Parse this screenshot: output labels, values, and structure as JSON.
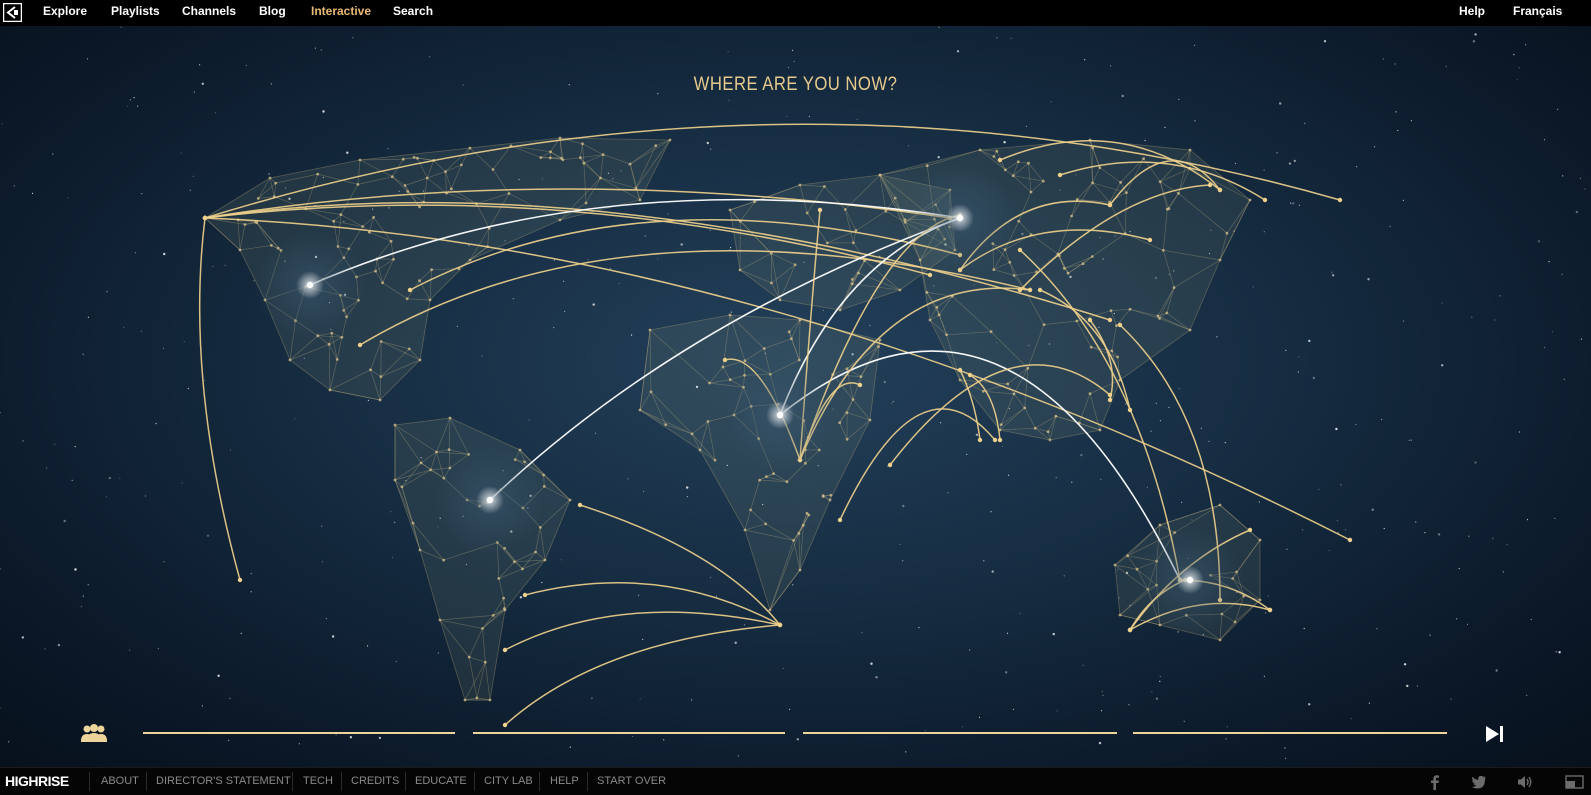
{
  "nav": {
    "items": [
      {
        "label": "Explore",
        "active": false
      },
      {
        "label": "Playlists",
        "active": false
      },
      {
        "label": "Channels",
        "active": false
      },
      {
        "label": "Blog",
        "active": false
      },
      {
        "label": "Interactive",
        "active": true
      },
      {
        "label": "Search",
        "active": false
      }
    ],
    "help_label": "Help",
    "language_label": "Français"
  },
  "stage": {
    "title": "WHERE ARE YOU NOW?"
  },
  "controls": {
    "people_icon": "people-icon",
    "skip_icon": "skip-next-icon",
    "progress_segments": [
      1,
      1,
      1,
      1
    ]
  },
  "footer": {
    "brand": "HIGHRISE",
    "links": [
      "ABOUT",
      "DIRECTOR'S STATEMENT",
      "TECH",
      "CREDITS",
      "EDUCATE",
      "CITY LAB",
      "HELP",
      "START OVER"
    ],
    "icons": [
      "facebook-icon",
      "twitter-icon",
      "volume-icon",
      "fullscreen-icon"
    ]
  },
  "colors": {
    "accent": "#e9b973",
    "arc": "#f1d28c",
    "arc_highlight": "#ffffff",
    "background": "#152b40"
  }
}
